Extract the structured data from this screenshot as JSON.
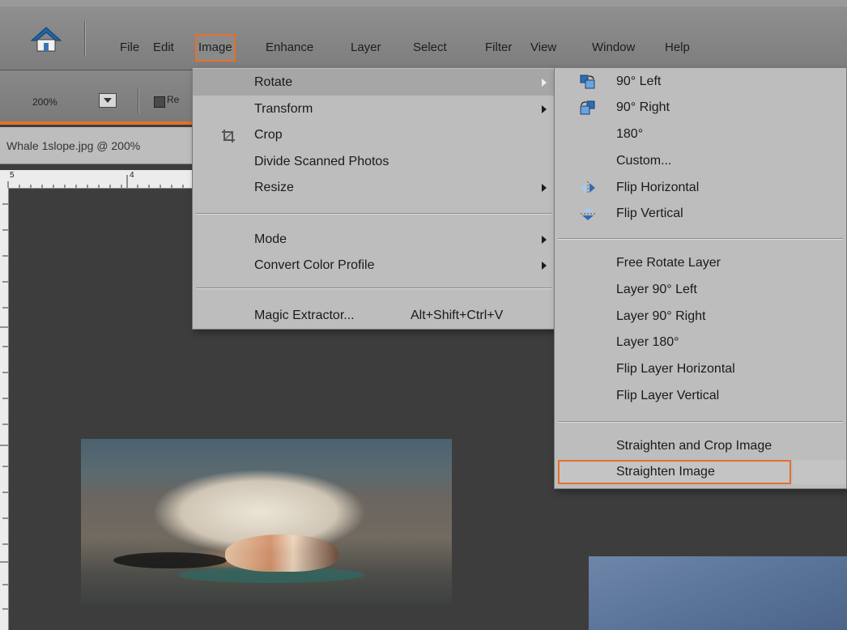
{
  "menubar": {
    "items": [
      "File",
      "Edit",
      "Image",
      "Enhance",
      "Layer",
      "Select",
      "Filter",
      "View",
      "Window",
      "Help"
    ],
    "active": "Image"
  },
  "options": {
    "zoom_value": "200%",
    "checkbox_label": "Re"
  },
  "document": {
    "tab_title": "Whale 1slope.jpg @ 200%",
    "ruler_labels": [
      "5",
      "4"
    ]
  },
  "image_menu": {
    "items": [
      {
        "label": "Rotate",
        "submenu": true,
        "highlighted": true
      },
      {
        "label": "Transform",
        "submenu": true
      },
      {
        "label": "Crop",
        "icon": "crop-icon"
      },
      {
        "label": "Divide Scanned Photos"
      },
      {
        "label": "Resize",
        "submenu": true
      },
      {
        "label": "Mode",
        "submenu": true
      },
      {
        "label": "Convert Color Profile",
        "submenu": true
      },
      {
        "label": "Magic Extractor...",
        "shortcut": "Alt+Shift+Ctrl+V"
      }
    ]
  },
  "rotate_submenu": {
    "items": [
      {
        "label": "90° Left",
        "icon": "rotate-left-icon"
      },
      {
        "label": "90° Right",
        "icon": "rotate-right-icon"
      },
      {
        "label": "180°"
      },
      {
        "label": "Custom..."
      },
      {
        "label": "Flip Horizontal",
        "icon": "flip-horizontal-icon"
      },
      {
        "label": "Flip Vertical",
        "icon": "flip-vertical-icon"
      },
      {
        "label": "Free Rotate Layer"
      },
      {
        "label": "Layer 90° Left"
      },
      {
        "label": "Layer 90° Right"
      },
      {
        "label": "Layer 180°"
      },
      {
        "label": "Flip Layer Horizontal"
      },
      {
        "label": "Flip Layer Vertical"
      },
      {
        "label": "Straighten and Crop Image"
      },
      {
        "label": "Straighten Image",
        "highlighted": true
      }
    ]
  },
  "colors": {
    "accent_orange": "#e5702a",
    "menu_bg": "#bdbdbd",
    "canvas_bg": "#3d3d3d"
  }
}
